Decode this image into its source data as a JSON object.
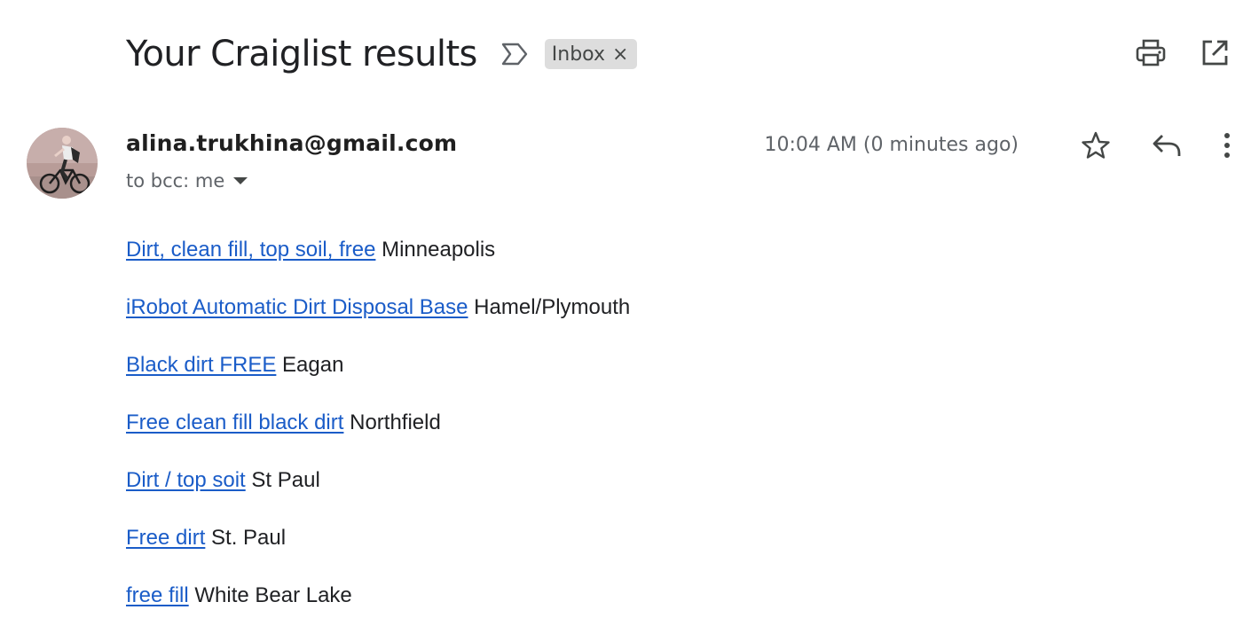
{
  "subject": "Your Craiglist results",
  "label": {
    "name": "Inbox",
    "close": "×"
  },
  "header_actions": [
    {
      "name": "print-all-icon"
    },
    {
      "name": "open-in-new-window-icon"
    }
  ],
  "sender": {
    "email": "alina.trukhina@gmail.com",
    "recipients": "to bcc: me",
    "avatar_icon": "cyclist-photo-avatar"
  },
  "timestamp": "10:04 AM (0 minutes ago)",
  "message_actions": [
    {
      "name": "star-icon"
    },
    {
      "name": "reply-icon"
    },
    {
      "name": "more-options-icon"
    }
  ],
  "colors": {
    "link": "#1a5cc8",
    "chip_bg": "#dddddd",
    "secondary_text": "#5f6368"
  },
  "results": [
    {
      "title": "Dirt, clean fill, top soil, free",
      "location": "Minneapolis"
    },
    {
      "title": "iRobot Automatic Dirt Disposal Base",
      "location": "Hamel/Plymouth"
    },
    {
      "title": "Black dirt FREE",
      "location": "Eagan"
    },
    {
      "title": "Free clean fill black dirt",
      "location": "Northfield"
    },
    {
      "title": "Dirt / top soit",
      "location": "St Paul"
    },
    {
      "title": "Free dirt",
      "location": "St. Paul"
    },
    {
      "title": "free fill",
      "location": "White Bear Lake"
    }
  ]
}
